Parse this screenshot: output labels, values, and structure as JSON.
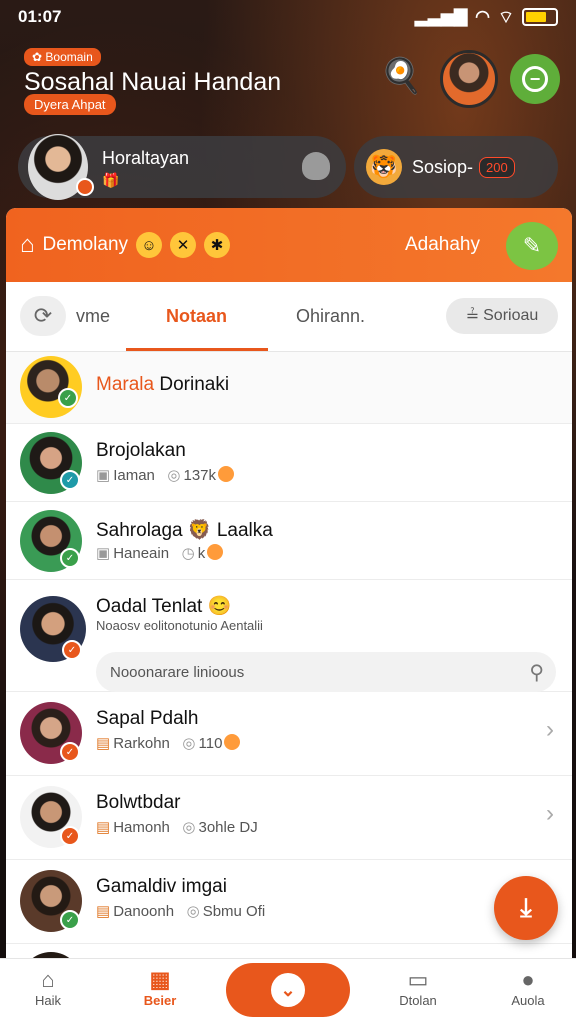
{
  "status_bar": {
    "time": "01:07"
  },
  "header": {
    "tagline": "Boomain",
    "title": "Sosahal Nauai Handan",
    "subtitle": "Dyera Ahpat"
  },
  "profile": {
    "name": "Horaltayan"
  },
  "score": {
    "label": "Sosiop-",
    "value": "200"
  },
  "banner": {
    "left_label": "Demolany",
    "right_label": "Adahahy"
  },
  "tabs": {
    "items": [
      "vme",
      "Notaan",
      "Ohirann."
    ],
    "active": "Notaan",
    "filter_label": "Sorioau"
  },
  "list": [
    {
      "name_highlight": "Marala",
      "name_rest": " Dorinaki"
    },
    {
      "name": "Brojolakan",
      "meta1": "Iaman",
      "meta2": "137k"
    },
    {
      "name": "Sahrolaga 🦁 Laalka",
      "meta1": "Haneain",
      "meta2": "k"
    },
    {
      "name": "Oadal Tenlat 😊",
      "preview": "Noaosv eolitonotunio Aentalii",
      "input_placeholder": "Nooonarare linioous"
    },
    {
      "name": "Sapal Pdalh",
      "meta1": "Rarkohn",
      "meta2": "110"
    },
    {
      "name": "Bolwtbdar",
      "meta1": "Hamonh",
      "meta2": "3ohle DJ"
    },
    {
      "name": "Gamaldiv imgai",
      "meta1": "Danoonh",
      "meta2": "Sbmu Ofi"
    }
  ],
  "bottom_nav": {
    "items": [
      "Haik",
      "Beier",
      "Dtolan",
      "Auola"
    ],
    "active": "Beier"
  }
}
